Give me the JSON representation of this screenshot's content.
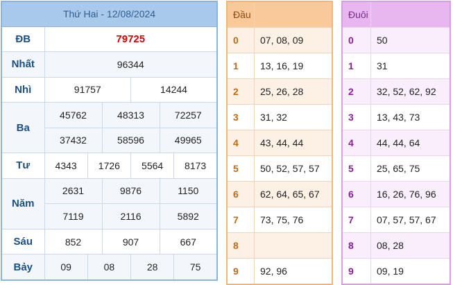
{
  "header": {
    "title": "Thứ Hai - 12/08/2024"
  },
  "prizes": {
    "db": {
      "label": "ĐB",
      "values": [
        "79725"
      ]
    },
    "nhat": {
      "label": "Nhất",
      "values": [
        "96344"
      ]
    },
    "nhi": {
      "label": "Nhì",
      "values": [
        "91757",
        "14244"
      ]
    },
    "ba": {
      "label": "Ba",
      "values": [
        "45762",
        "48313",
        "72257",
        "37432",
        "58596",
        "49965"
      ]
    },
    "tu": {
      "label": "Tư",
      "values": [
        "4343",
        "1726",
        "5564",
        "8173"
      ]
    },
    "nam": {
      "label": "Năm",
      "values": [
        "2631",
        "9876",
        "1150",
        "7119",
        "2116",
        "5892"
      ]
    },
    "sau": {
      "label": "Sáu",
      "values": [
        "852",
        "907",
        "667"
      ]
    },
    "bay": {
      "label": "Bảy",
      "values": [
        "09",
        "08",
        "28",
        "75"
      ]
    }
  },
  "dau": {
    "header": "Đầu",
    "rows": [
      {
        "key": "0",
        "values": "07, 08, 09"
      },
      {
        "key": "1",
        "values": "13, 16, 19"
      },
      {
        "key": "2",
        "values": "25, 26, 28"
      },
      {
        "key": "3",
        "values": "31, 32"
      },
      {
        "key": "4",
        "values": "43, 44, 44"
      },
      {
        "key": "5",
        "values": "50, 52, 57, 57"
      },
      {
        "key": "6",
        "values": "62, 64, 65, 67"
      },
      {
        "key": "7",
        "values": "73, 75, 76"
      },
      {
        "key": "8",
        "values": ""
      },
      {
        "key": "9",
        "values": "92, 96"
      }
    ]
  },
  "duoi": {
    "header": "Đuôi",
    "rows": [
      {
        "key": "0",
        "values": "50"
      },
      {
        "key": "1",
        "values": "31"
      },
      {
        "key": "2",
        "values": "32, 52, 62, 92"
      },
      {
        "key": "3",
        "values": "13, 43, 73"
      },
      {
        "key": "4",
        "values": "44, 44, 64"
      },
      {
        "key": "5",
        "values": "25, 65, 75"
      },
      {
        "key": "6",
        "values": "16, 26, 76, 96"
      },
      {
        "key": "7",
        "values": "07, 57, 57, 67"
      },
      {
        "key": "8",
        "values": "08, 28"
      },
      {
        "key": "9",
        "values": "09, 19"
      }
    ]
  },
  "colors": {
    "special_prize": "#d40000",
    "main_header": "#a9c9ea",
    "dau_header": "#f9c99a",
    "duoi_header": "#e9b7ef"
  }
}
